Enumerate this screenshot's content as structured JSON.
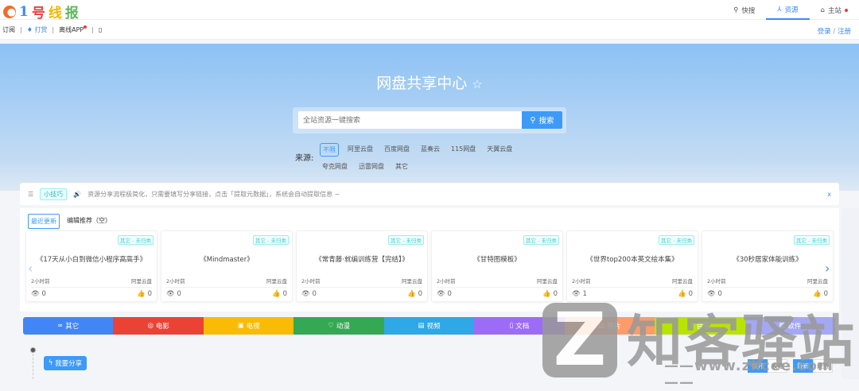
{
  "header": {
    "logo_text": [
      "1",
      "号",
      "线",
      "报"
    ],
    "nav": [
      {
        "icon": "search-icon",
        "label": "快搜"
      },
      {
        "icon": "share-nodes-icon",
        "label": "资源",
        "active": true
      },
      {
        "icon": "home-icon",
        "label": "主站",
        "badge": true
      }
    ]
  },
  "subbar": {
    "items": [
      "订阅",
      "打赏",
      "离线APP"
    ],
    "login": "登录",
    "sep": "/",
    "register": "注册"
  },
  "hero": {
    "title": "网盘共享中心",
    "star": "☆",
    "search_placeholder": "全站资源一键搜索",
    "search_button": "搜索",
    "source_label": "来源:",
    "sources": [
      "不限",
      "阿里云盘",
      "百度网盘",
      "蓝奏云",
      "115网盘",
      "天翼云盘",
      "夸克网盘",
      "迅雷网盘",
      "其它"
    ],
    "selected_source": "不限"
  },
  "notice": {
    "tag": "小技巧",
    "text": "资源分享流程极简化，只需要填写分享链接，点击「提取元数据」，系统会自动提取信息 ~",
    "close": "x"
  },
  "tabs": [
    "最近更新",
    "编辑推荐（空）"
  ],
  "cards": [
    {
      "category": "其它 - 未归类",
      "name": "《17天从小白到微信小程序高高手》",
      "time": "2小时前",
      "platform": "阿里云盘",
      "views": "0",
      "likes": "0"
    },
    {
      "category": "其它 - 未归类",
      "name": "《Mindmaster》",
      "time": "2小时前",
      "platform": "阿里云盘",
      "views": "0",
      "likes": "0"
    },
    {
      "category": "其它 - 未归类",
      "name": "《常青藤·就编训练营【完结】》",
      "time": "2小时前",
      "platform": "阿里云盘",
      "views": "0",
      "likes": "0"
    },
    {
      "category": "其它 - 未归类",
      "name": "《甘特图模板》",
      "time": "2小时前",
      "platform": "阿里云盘",
      "views": "0",
      "likes": "0"
    },
    {
      "category": "其它 - 未归类",
      "name": "《世界top200本英文绘本集》",
      "time": "2小时前",
      "platform": "阿里云盘",
      "views": "1",
      "likes": "0"
    },
    {
      "category": "其它 - 未归类",
      "name": "《30秒居家体能训练》",
      "time": "2小时前",
      "platform": "阿里云盘",
      "views": "0",
      "likes": "0"
    }
  ],
  "categories": [
    {
      "label": "其它",
      "icon": "infinity-icon",
      "color": "#4286f5"
    },
    {
      "label": "电影",
      "icon": "film-icon",
      "color": "#ea4335"
    },
    {
      "label": "电视",
      "icon": "tv-icon",
      "color": "#f9bb05"
    },
    {
      "label": "动漫",
      "icon": "anime-icon",
      "color": "#34a853"
    },
    {
      "label": "视频",
      "icon": "video-icon",
      "color": "#2ea8e6"
    },
    {
      "label": "文档",
      "icon": "document-icon",
      "color": "#9d6cf7"
    },
    {
      "label": "图片",
      "icon": "image-icon",
      "color": "#ff9b6a"
    },
    {
      "label": "音乐",
      "icon": "music-icon",
      "color": "#b7e400"
    },
    {
      "label": "软件",
      "icon": "software-icon",
      "color": "#a4a8f4"
    }
  ],
  "share_button": "我要分享",
  "toggle_buttons": [
    "展开",
    "收缩"
  ],
  "sort_buttons": [
    "最新",
    "最热"
  ],
  "watermark": {
    "letter": "Z",
    "name": "知客驿站",
    "url": "——www.zkcee.com——"
  }
}
